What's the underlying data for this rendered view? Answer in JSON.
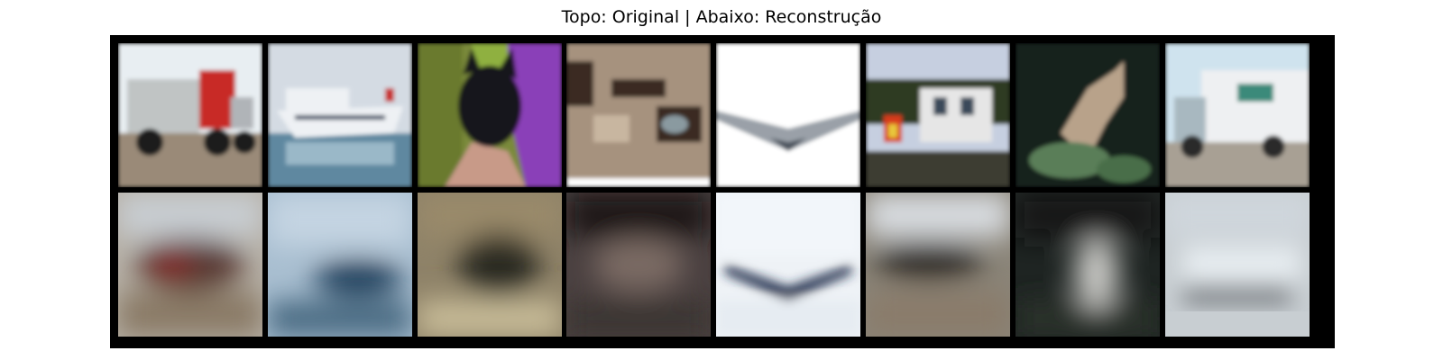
{
  "figure": {
    "title": "Topo: Original | Abaixo: Reconstrução"
  },
  "rows": [
    {
      "row": "original",
      "images": [
        {
          "subject": "truck",
          "colors": {
            "sky": "#e8eef2",
            "ground": "#9a8a78",
            "body": "#c0c4c4",
            "accent": "#c82a28",
            "wheel": "#1c1c1c"
          }
        },
        {
          "subject": "ship",
          "colors": {
            "sky": "#d4dbe3",
            "water": "#5f88a0",
            "hull": "#eef1f4",
            "accent": "#2c3e5a"
          }
        },
        {
          "subject": "cat",
          "colors": {
            "bg": "#7a8a3a",
            "cloth": "#8a3fb8",
            "skin": "#c89a88",
            "cat": "#15161a",
            "accent": "#8fb040"
          }
        },
        {
          "subject": "cat",
          "colors": {
            "bg": "#a6927e",
            "fur_dark": "#3a2c22",
            "fur_light": "#c8b6a0",
            "eye": "#8a9aa0"
          }
        },
        {
          "subject": "airplane",
          "colors": {
            "sky": "#ffffff",
            "plane": "#9aa0a8",
            "shadow": "#505660"
          }
        },
        {
          "subject": "ship",
          "colors": {
            "sky": "#c6cfe0",
            "trees": "#2e3b24",
            "boat": "#e6e6e6",
            "person": "#d83a1c",
            "accent": "#e8c83a",
            "water": "#3c3e30"
          }
        },
        {
          "subject": "cat",
          "colors": {
            "bg": "#18221c",
            "cat": "#b8a28a",
            "leaves": "#5a7e58"
          }
        },
        {
          "subject": "truck",
          "colors": {
            "sky": "#cfe3ee",
            "box": "#eef0f2",
            "logo": "#3a8a7a",
            "cab": "#a8b8c0",
            "ground": "#a8a094",
            "wheel": "#2a2a2a"
          }
        }
      ]
    },
    {
      "row": "reconstruction",
      "images": [
        {
          "subject": "truck",
          "colors": {
            "top": "#c8cdd2",
            "mid": "#5a3a34",
            "accent": "#8a2626",
            "bottom": "#8a7a66"
          }
        },
        {
          "subject": "ship",
          "colors": {
            "top": "#c4d4e2",
            "mid": "#1e3c5a",
            "bottom": "#4a6a82"
          }
        },
        {
          "subject": "cat",
          "colors": {
            "top": "#9a8a6a",
            "mid": "#2a2a22",
            "bottom": "#c8bc98"
          }
        },
        {
          "subject": "cat",
          "colors": {
            "top": "#1a1616",
            "mid": "#7a6a64",
            "bottom": "#3a3430"
          }
        },
        {
          "subject": "airplane",
          "colors": {
            "top": "#f2f6fa",
            "mid": "#1e2a4a",
            "bottom": "#e6ecf2"
          }
        },
        {
          "subject": "ship",
          "colors": {
            "top": "#d8dce0",
            "mid": "#2a2620",
            "bottom": "#8a7c6a"
          }
        },
        {
          "subject": "cat",
          "colors": {
            "top": "#141818",
            "mid": "#c8c8c4",
            "bottom": "#2a302a"
          }
        },
        {
          "subject": "truck",
          "colors": {
            "top": "#cfd6dc",
            "mid": "#e6ecf0",
            "bottom": "#4a4e52"
          }
        }
      ]
    }
  ]
}
